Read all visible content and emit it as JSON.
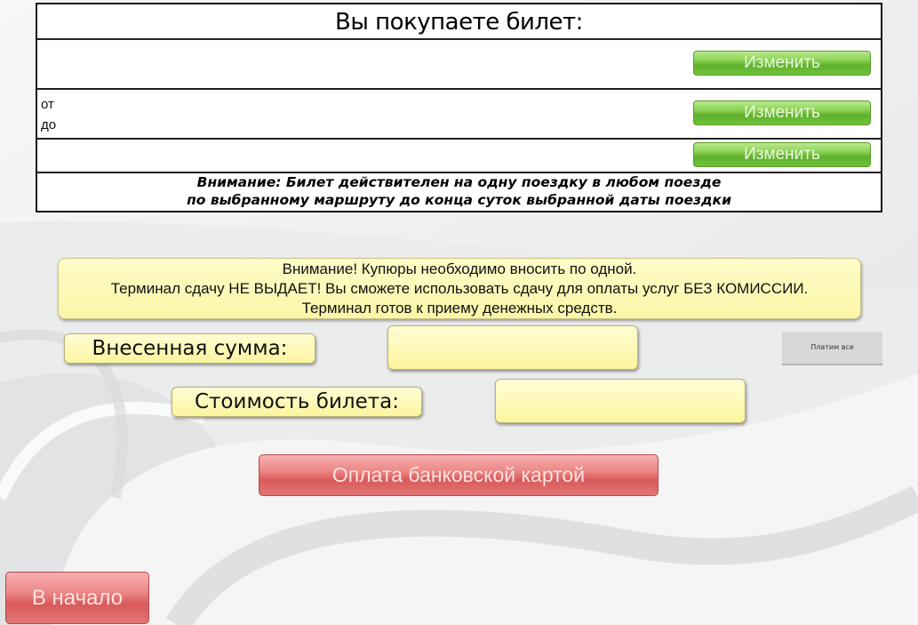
{
  "ticket": {
    "title": "Вы покупаете билет:",
    "from_label": "от",
    "to_label": "до",
    "change_label": "Изменить",
    "notice_line1": "Внимание: Билет действителен на одну поездку в любом поезде",
    "notice_line2": "по выбранному маршруту до конца суток выбранной даты поездки"
  },
  "info": {
    "line1": "Внимание! Купюры необходимо вносить по одной.",
    "line2": "Терминал сдачу НЕ ВЫДАЕТ! Вы сможете использовать сдачу для оплаты услуг БЕЗ КОМИССИИ.",
    "line3": "Терминал готов к приему денежных средств."
  },
  "payment": {
    "deposited_label": "Внесенная сумма:",
    "deposited_value": "",
    "price_label": "Стоимость билета:",
    "price_value": "",
    "pay_all_label": "Платим все",
    "card_pay_label": "Оплата банковской картой"
  },
  "nav": {
    "home_label": "В начало"
  },
  "colors": {
    "green_button": "#6fc23a",
    "red_button": "#e27676",
    "yellow_field": "#fbf6a8"
  }
}
